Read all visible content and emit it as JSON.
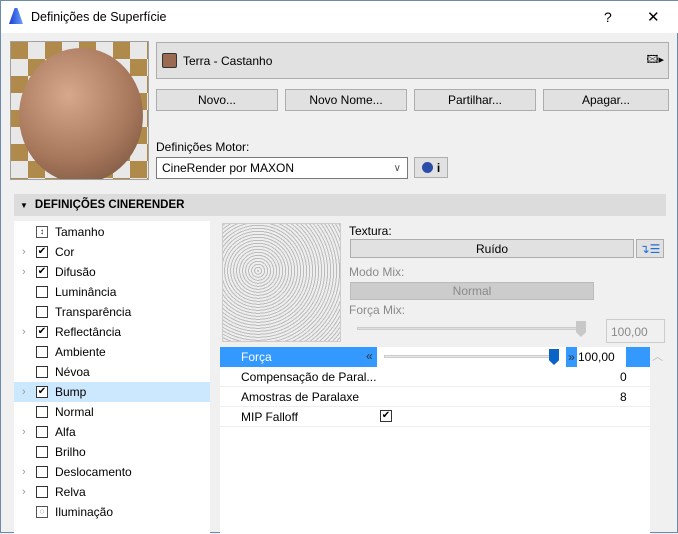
{
  "window": {
    "title": "Definições de Superfície",
    "help": "?",
    "close": "✕"
  },
  "surface": {
    "name": "Terra - Castanho",
    "swatch_color": "#9a6a52"
  },
  "buttons": {
    "new": "Novo...",
    "new_name": "Novo Nome...",
    "share": "Partilhar...",
    "delete": "Apagar..."
  },
  "engine": {
    "label": "Definições Motor:",
    "value": "CineRender por MAXON",
    "info": "i"
  },
  "section": {
    "title": "DEFINIÇÕES CINERENDER"
  },
  "channels": [
    {
      "label": "Tamanho",
      "type": "icon",
      "expand": false
    },
    {
      "label": "Cor",
      "checked": true,
      "expand": true
    },
    {
      "label": "Difusão",
      "checked": true,
      "expand": true
    },
    {
      "label": "Luminância",
      "checked": false,
      "expand": false
    },
    {
      "label": "Transparência",
      "checked": false,
      "expand": false
    },
    {
      "label": "Reflectância",
      "checked": true,
      "expand": true
    },
    {
      "label": "Ambiente",
      "checked": false,
      "expand": false
    },
    {
      "label": "Névoa",
      "checked": false,
      "expand": false
    },
    {
      "label": "Bump",
      "checked": true,
      "expand": true,
      "selected": true
    },
    {
      "label": "Normal",
      "checked": false,
      "expand": false
    },
    {
      "label": "Alfa",
      "checked": false,
      "expand": true
    },
    {
      "label": "Brilho",
      "checked": false,
      "expand": false
    },
    {
      "label": "Deslocamento",
      "checked": false,
      "expand": true
    },
    {
      "label": "Relva",
      "checked": false,
      "expand": true
    },
    {
      "label": "Iluminação",
      "type": "icon",
      "expand": false
    }
  ],
  "texture": {
    "label": "Textura:",
    "value": "Ruído",
    "mix_mode_label": "Modo Mix:",
    "mix_mode": "Normal",
    "mix_strength_label": "Força Mix:",
    "mix_strength": "100,00",
    "mix_strength_fraction": 1.0
  },
  "params": {
    "strength": {
      "label": "Força",
      "value": "100,00",
      "fraction": 1.0
    },
    "parallax_offset": {
      "label": "Compensação de Paral...",
      "value": "0"
    },
    "parallax_samples": {
      "label": "Amostras de Paralaxe",
      "value": "8"
    },
    "mip_falloff": {
      "label": "MIP Falloff",
      "checked": true
    }
  },
  "colors": {
    "accent": "#3399ff",
    "selected_row": "#cce8ff"
  }
}
